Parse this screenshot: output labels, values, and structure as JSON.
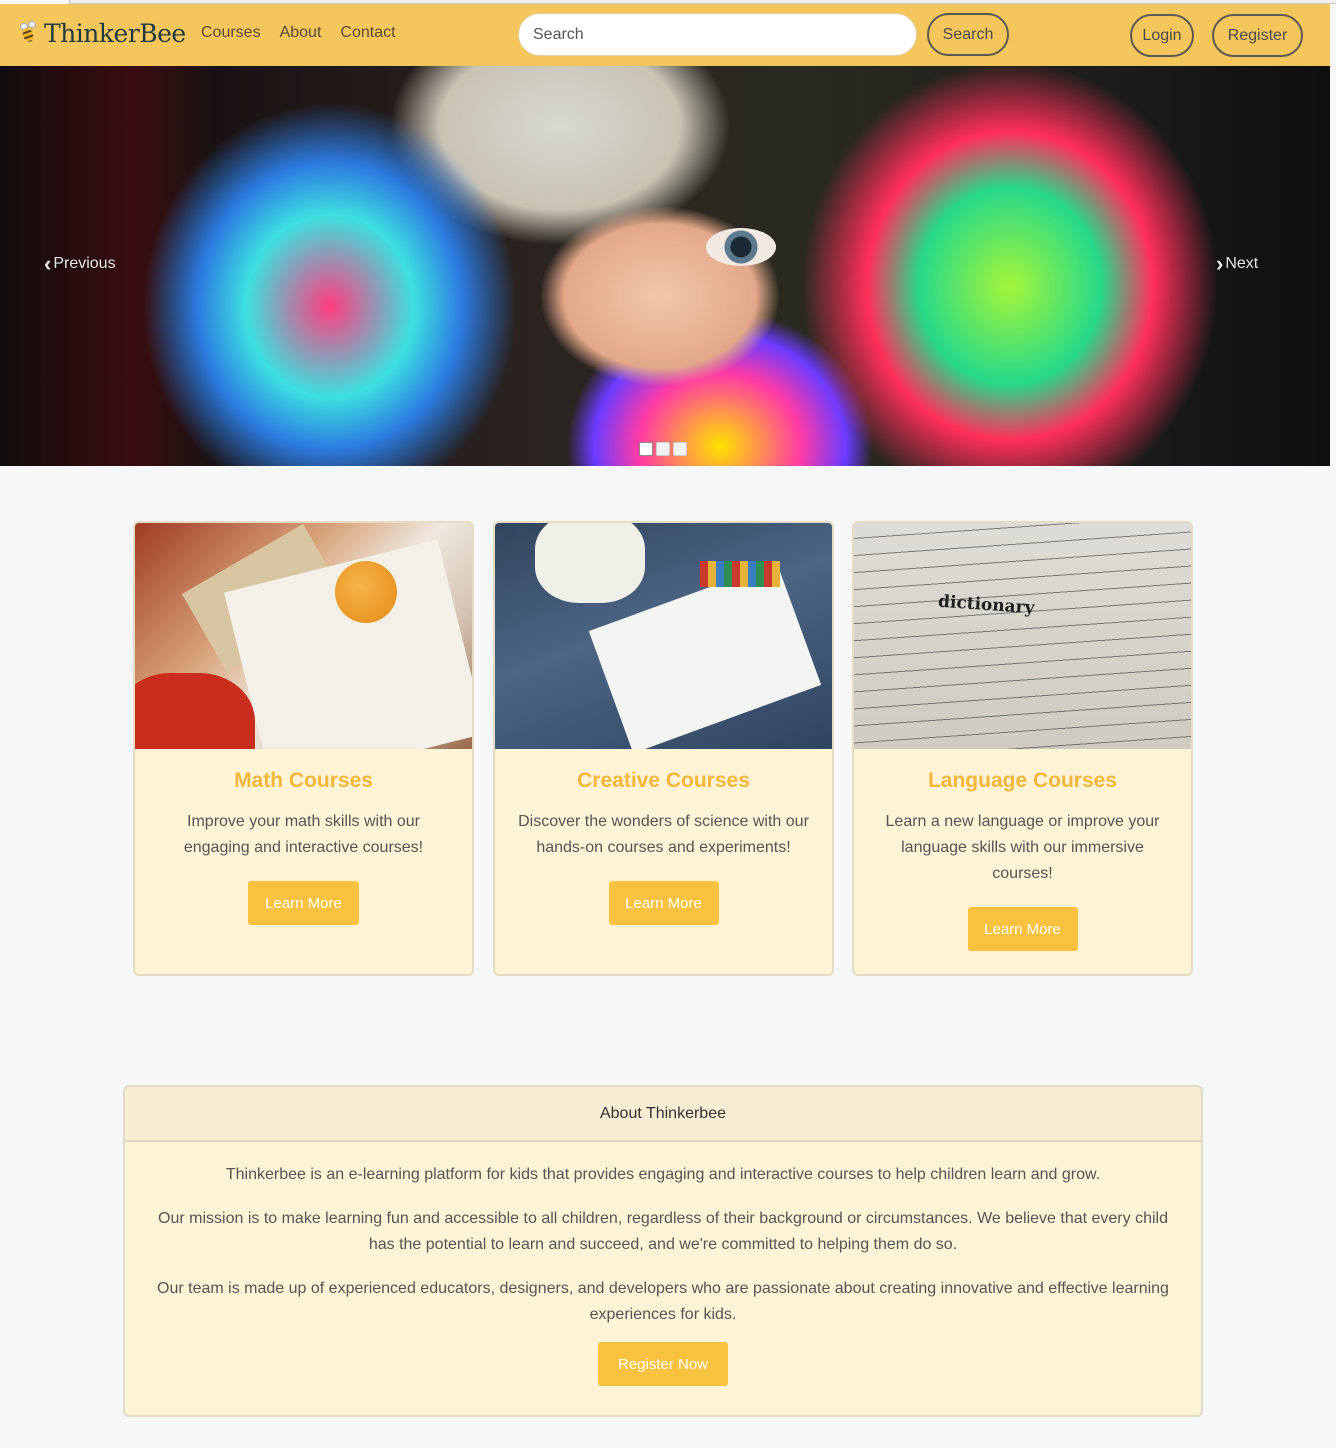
{
  "navbar": {
    "brand": "ThinkerBee",
    "links": [
      "Courses",
      "About",
      "Contact"
    ],
    "search_placeholder": "Search",
    "search_button": "Search",
    "login": "Login",
    "register": "Register"
  },
  "carousel": {
    "previous": "Previous",
    "next": "Next",
    "slide_count": 3,
    "active_index": 0
  },
  "courses": [
    {
      "title": "Math Courses",
      "text": "Improve your math skills with our engaging and interactive courses!",
      "button": "Learn More"
    },
    {
      "title": "Creative Courses",
      "text": "Discover the wonders of science with our hands-on courses and experiments!",
      "button": "Learn More"
    },
    {
      "title": "Language Courses",
      "text": "Learn a new language or improve your language skills with our immersive courses!",
      "button": "Learn More"
    }
  ],
  "about": {
    "header": "About Thinkerbee",
    "paragraphs": [
      "Thinkerbee is an e-learning platform for kids that provides engaging and interactive courses to help children learn and grow.",
      "Our mission is to make learning fun and accessible to all children, regardless of their background or circumstances. We believe that every child has the potential to learn and succeed, and we're committed to helping them do so.",
      "Our team is made up of experienced educators, designers, and developers who are passionate about creating innovative and effective learning experiences for kids."
    ],
    "button": "Register Now"
  },
  "colors": {
    "navbar_bg": "#f5c65c",
    "accent": "#f9c140",
    "card_bg": "#fdf4d6",
    "title_color": "#f2b63a"
  },
  "icons": {
    "brand": "bee-icon",
    "previous": "chevron-left-icon",
    "next": "chevron-right-icon"
  },
  "image_text": {
    "language_card": "dictionary"
  }
}
